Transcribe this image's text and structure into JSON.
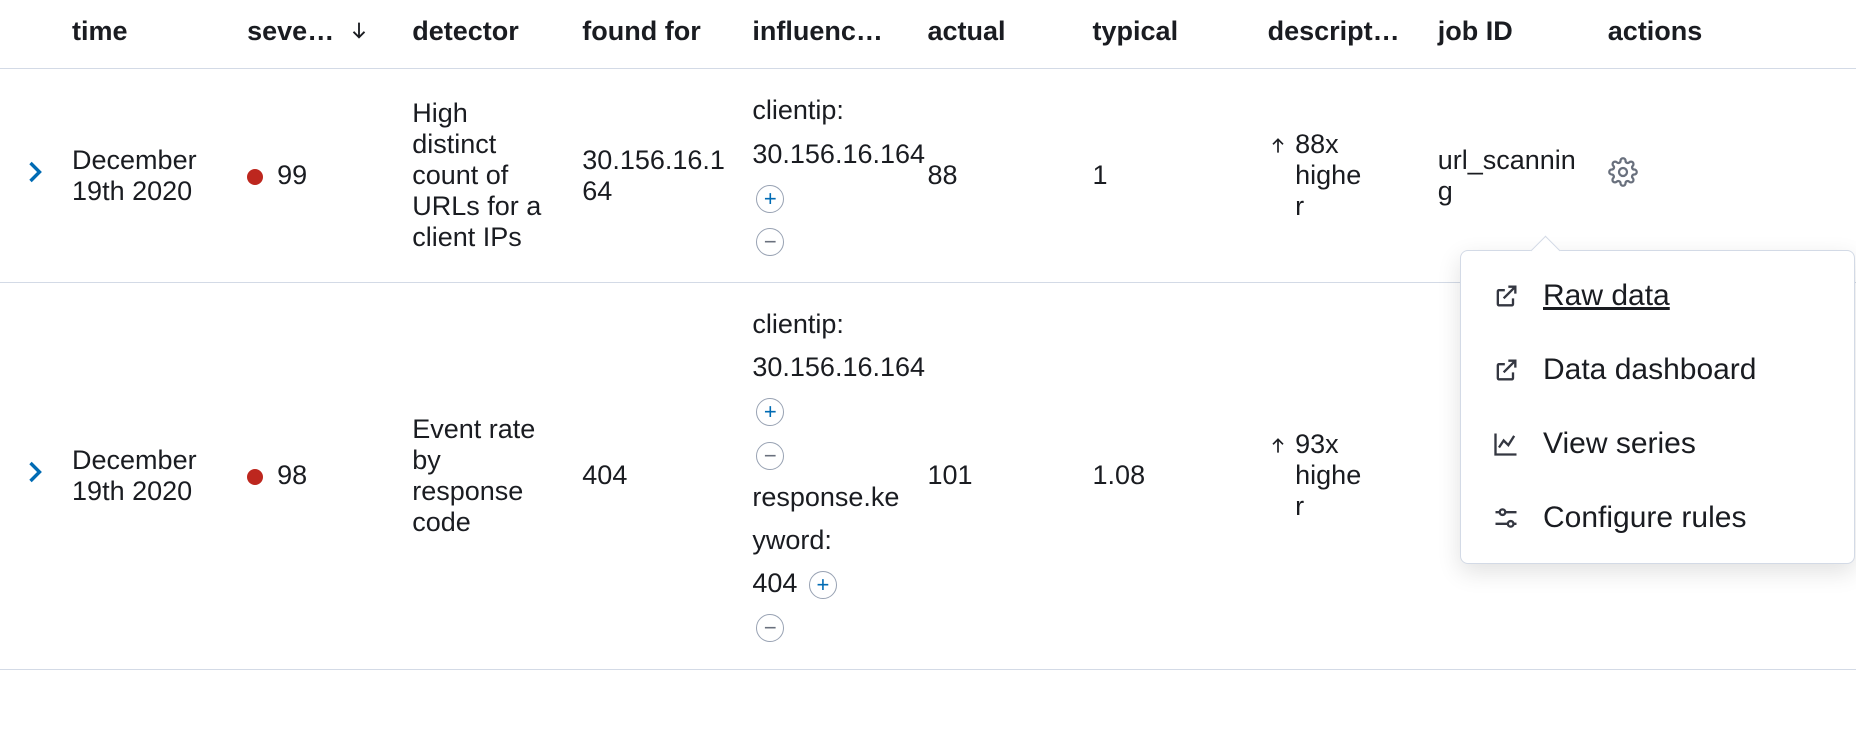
{
  "columns": {
    "time": "time",
    "severity": "seve…",
    "detector": "detector",
    "found_for": "found for",
    "influencers": "influenc…",
    "actual": "actual",
    "typical": "typical",
    "description": "descript…",
    "job_id": "job ID",
    "actions": "actions"
  },
  "rows": [
    {
      "time": "December 19th 2020",
      "severity": "99",
      "severity_color": "#bd271e",
      "detector": "High distinct count of URLs for a client IPs",
      "found_for": "30.156.16.164",
      "influencers": [
        {
          "label": "clientip:",
          "value": "30.156.16.164"
        }
      ],
      "actual": "88",
      "typical": "1",
      "description_dir": "up",
      "description": "88x higher",
      "job_id": "url_scanning"
    },
    {
      "time": "December 19th 2020",
      "severity": "98",
      "severity_color": "#bd271e",
      "detector": "Event rate by response code",
      "found_for": "404",
      "influencers": [
        {
          "label": "clientip:",
          "value": "30.156.16.164"
        },
        {
          "label": "response.keyword:",
          "value": "404"
        }
      ],
      "actual": "101",
      "typical": "1.08",
      "description_dir": "up",
      "description": "93x higher",
      "job_id": ""
    }
  ],
  "popover": {
    "raw_data": "Raw data",
    "data_dashboard": "Data dashboard",
    "view_series": "View series",
    "configure_rules": "Configure rules"
  }
}
